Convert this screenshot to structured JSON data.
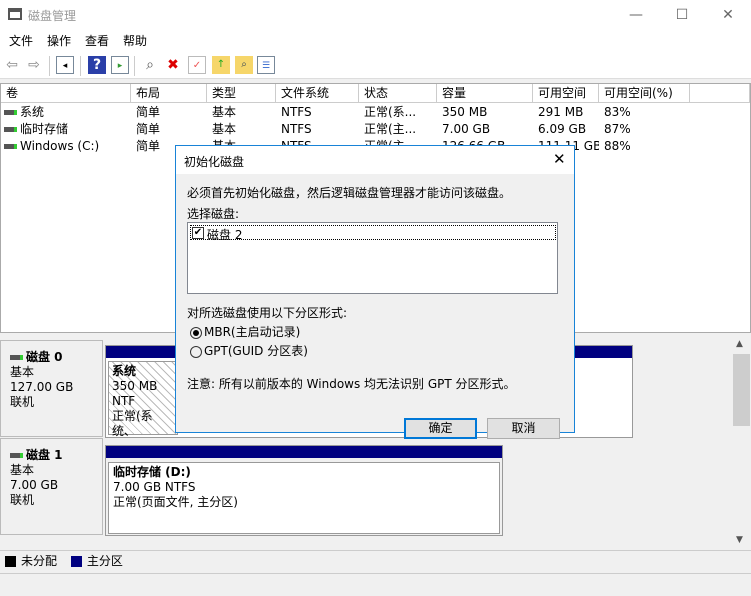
{
  "window": {
    "title": "磁盘管理",
    "minimize": "—",
    "maximize": "☐",
    "close": "✕"
  },
  "menu": [
    "文件",
    "操作",
    "查看",
    "帮助"
  ],
  "toolbar": {
    "icons": [
      "back-icon",
      "forward-icon",
      "show-hide-console-icon",
      "help-icon",
      "action-pane-icon",
      "connect-drive-icon",
      "delete-icon",
      "check-icon",
      "folder-up-icon",
      "folder-search-icon",
      "properties-icon"
    ]
  },
  "volumes": {
    "headers": [
      "卷",
      "布局",
      "类型",
      "文件系统",
      "状态",
      "容量",
      "可用空间",
      "可用空间(%)"
    ],
    "rows": [
      [
        "系统",
        "简单",
        "基本",
        "NTFS",
        "正常(系...",
        "350 MB",
        "291 MB",
        "83%"
      ],
      [
        "临时存储",
        "简单",
        "基本",
        "NTFS",
        "正常(主...",
        "7.00 GB",
        "6.09 GB",
        "87%"
      ],
      [
        "Windows (C:)",
        "简单",
        "基本",
        "NTFS",
        "正常(主...",
        "126.66 GB",
        "111.11 GB",
        "88%"
      ]
    ]
  },
  "disks": [
    {
      "name": "磁盘 0",
      "type": "基本",
      "size": "127.00 GB",
      "state": "联机",
      "partition": {
        "name": "系统",
        "info": "350 MB NTF",
        "status": "正常(系统、"
      }
    },
    {
      "name": "磁盘 1",
      "type": "基本",
      "size": "7.00 GB",
      "state": "联机",
      "partition": {
        "name": "临时存储 (D:)",
        "info": "7.00 GB NTFS",
        "status": "正常(页面文件, 主分区)"
      }
    }
  ],
  "legend": [
    {
      "label": "未分配",
      "color": "#000000"
    },
    {
      "label": "主分区",
      "color": "#000080"
    }
  ],
  "dialog": {
    "title": "初始化磁盘",
    "message": "必须首先初始化磁盘，然后逻辑磁盘管理器才能访问该磁盘。",
    "select_label": "选择磁盘:",
    "disk_item": "磁盘 2",
    "disk_checked": true,
    "style_label": "对所选磁盘使用以下分区形式:",
    "options": [
      "MBR(主启动记录)",
      "GPT(GUID 分区表)"
    ],
    "selected_option": "MBR(主启动记录)",
    "note": "注意: 所有以前版本的 Windows 均无法识别 GPT 分区形式。",
    "ok": "确定",
    "cancel": "取消"
  }
}
